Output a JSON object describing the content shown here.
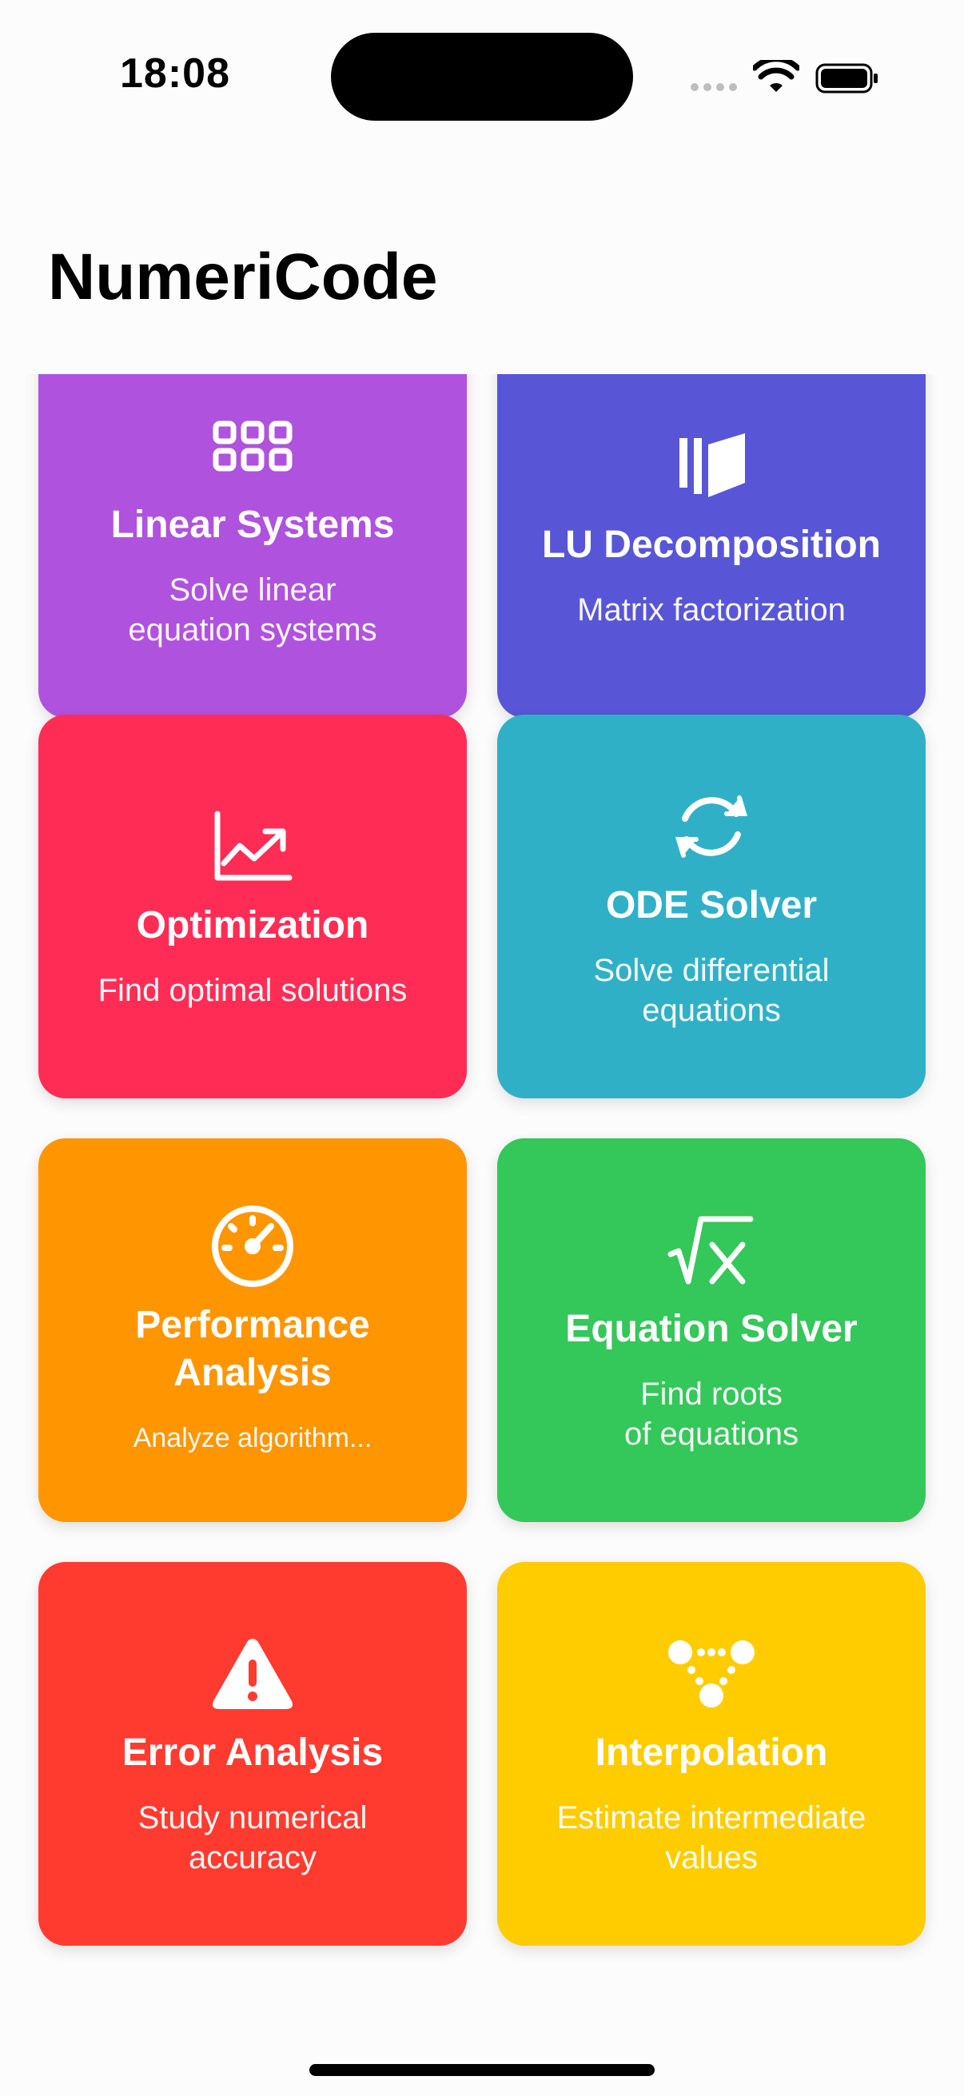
{
  "status_bar": {
    "time": "18:08"
  },
  "header": {
    "title": "NumeriCode"
  },
  "cards": [
    {
      "title": "Linear Systems",
      "subtitle": "Solve linear\nequation systems",
      "icon": "grid-icon",
      "color": "#AF52DE"
    },
    {
      "title": "LU Decomposition",
      "subtitle": "Matrix factorization",
      "icon": "layers-icon",
      "color": "#5856D6"
    },
    {
      "title": "Optimization",
      "subtitle": "Find optimal solutions",
      "icon": "trend-up-chart-icon",
      "color": "#FF2D55"
    },
    {
      "title": "ODE Solver",
      "subtitle": "Solve differential\nequations",
      "icon": "refresh-arrows-icon",
      "color": "#30B0C7"
    },
    {
      "title": "Performance\nAnalysis",
      "subtitle": "Analyze algorithm...",
      "icon": "gauge-icon",
      "color": "#FF9500"
    },
    {
      "title": "Equation Solver",
      "subtitle": "Find roots\nof equations",
      "icon": "square-root-icon",
      "color": "#34C759"
    },
    {
      "title": "Error Analysis",
      "subtitle": "Study numerical\naccuracy",
      "icon": "warning-triangle-icon",
      "color": "#FF3B30"
    },
    {
      "title": "Interpolation",
      "subtitle": "Estimate intermediate\nvalues",
      "icon": "dots-network-icon",
      "color": "#FFCC00"
    }
  ]
}
